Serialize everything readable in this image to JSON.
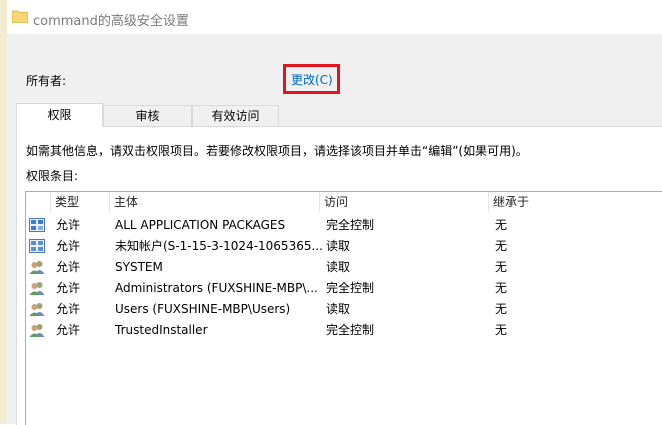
{
  "window": {
    "title": "command的高级安全设置"
  },
  "owner": {
    "label": "所有者:",
    "change_link": "更改(C)"
  },
  "tabs": [
    {
      "label": "权限",
      "active": true
    },
    {
      "label": "审核",
      "active": false
    },
    {
      "label": "有效访问",
      "active": false
    }
  ],
  "info_text": "如需其他信息，请双击权限项目。若要修改权限项目，请选择该项目并单击“编辑”(如果可用)。",
  "entries_label": "权限条目:",
  "table": {
    "headers": {
      "type": "类型",
      "principal": "主体",
      "access": "访问",
      "inherited": "继承于"
    },
    "rows": [
      {
        "icon": "app-packages-icon",
        "type": "允许",
        "principal": "ALL APPLICATION PACKAGES",
        "access": "完全控制",
        "inherited": "无"
      },
      {
        "icon": "unknown-account-icon",
        "type": "允许",
        "principal": "未知帐户(S-1-15-3-1024-1065365...",
        "access": "读取",
        "inherited": "无"
      },
      {
        "icon": "users-icon",
        "type": "允许",
        "principal": "SYSTEM",
        "access": "读取",
        "inherited": "无"
      },
      {
        "icon": "users-icon",
        "type": "允许",
        "principal": "Administrators (FUXSHINE-MBP\\...",
        "access": "完全控制",
        "inherited": "无"
      },
      {
        "icon": "users-icon",
        "type": "允许",
        "principal": "Users (FUXSHINE-MBP\\Users)",
        "access": "读取",
        "inherited": "无"
      },
      {
        "icon": "users-icon",
        "type": "允许",
        "principal": "TrustedInstaller",
        "access": "完全控制",
        "inherited": "无"
      }
    ]
  },
  "colors": {
    "link": "#0066cc",
    "highlight": "#e2141e",
    "background": "#f0f0f0"
  }
}
